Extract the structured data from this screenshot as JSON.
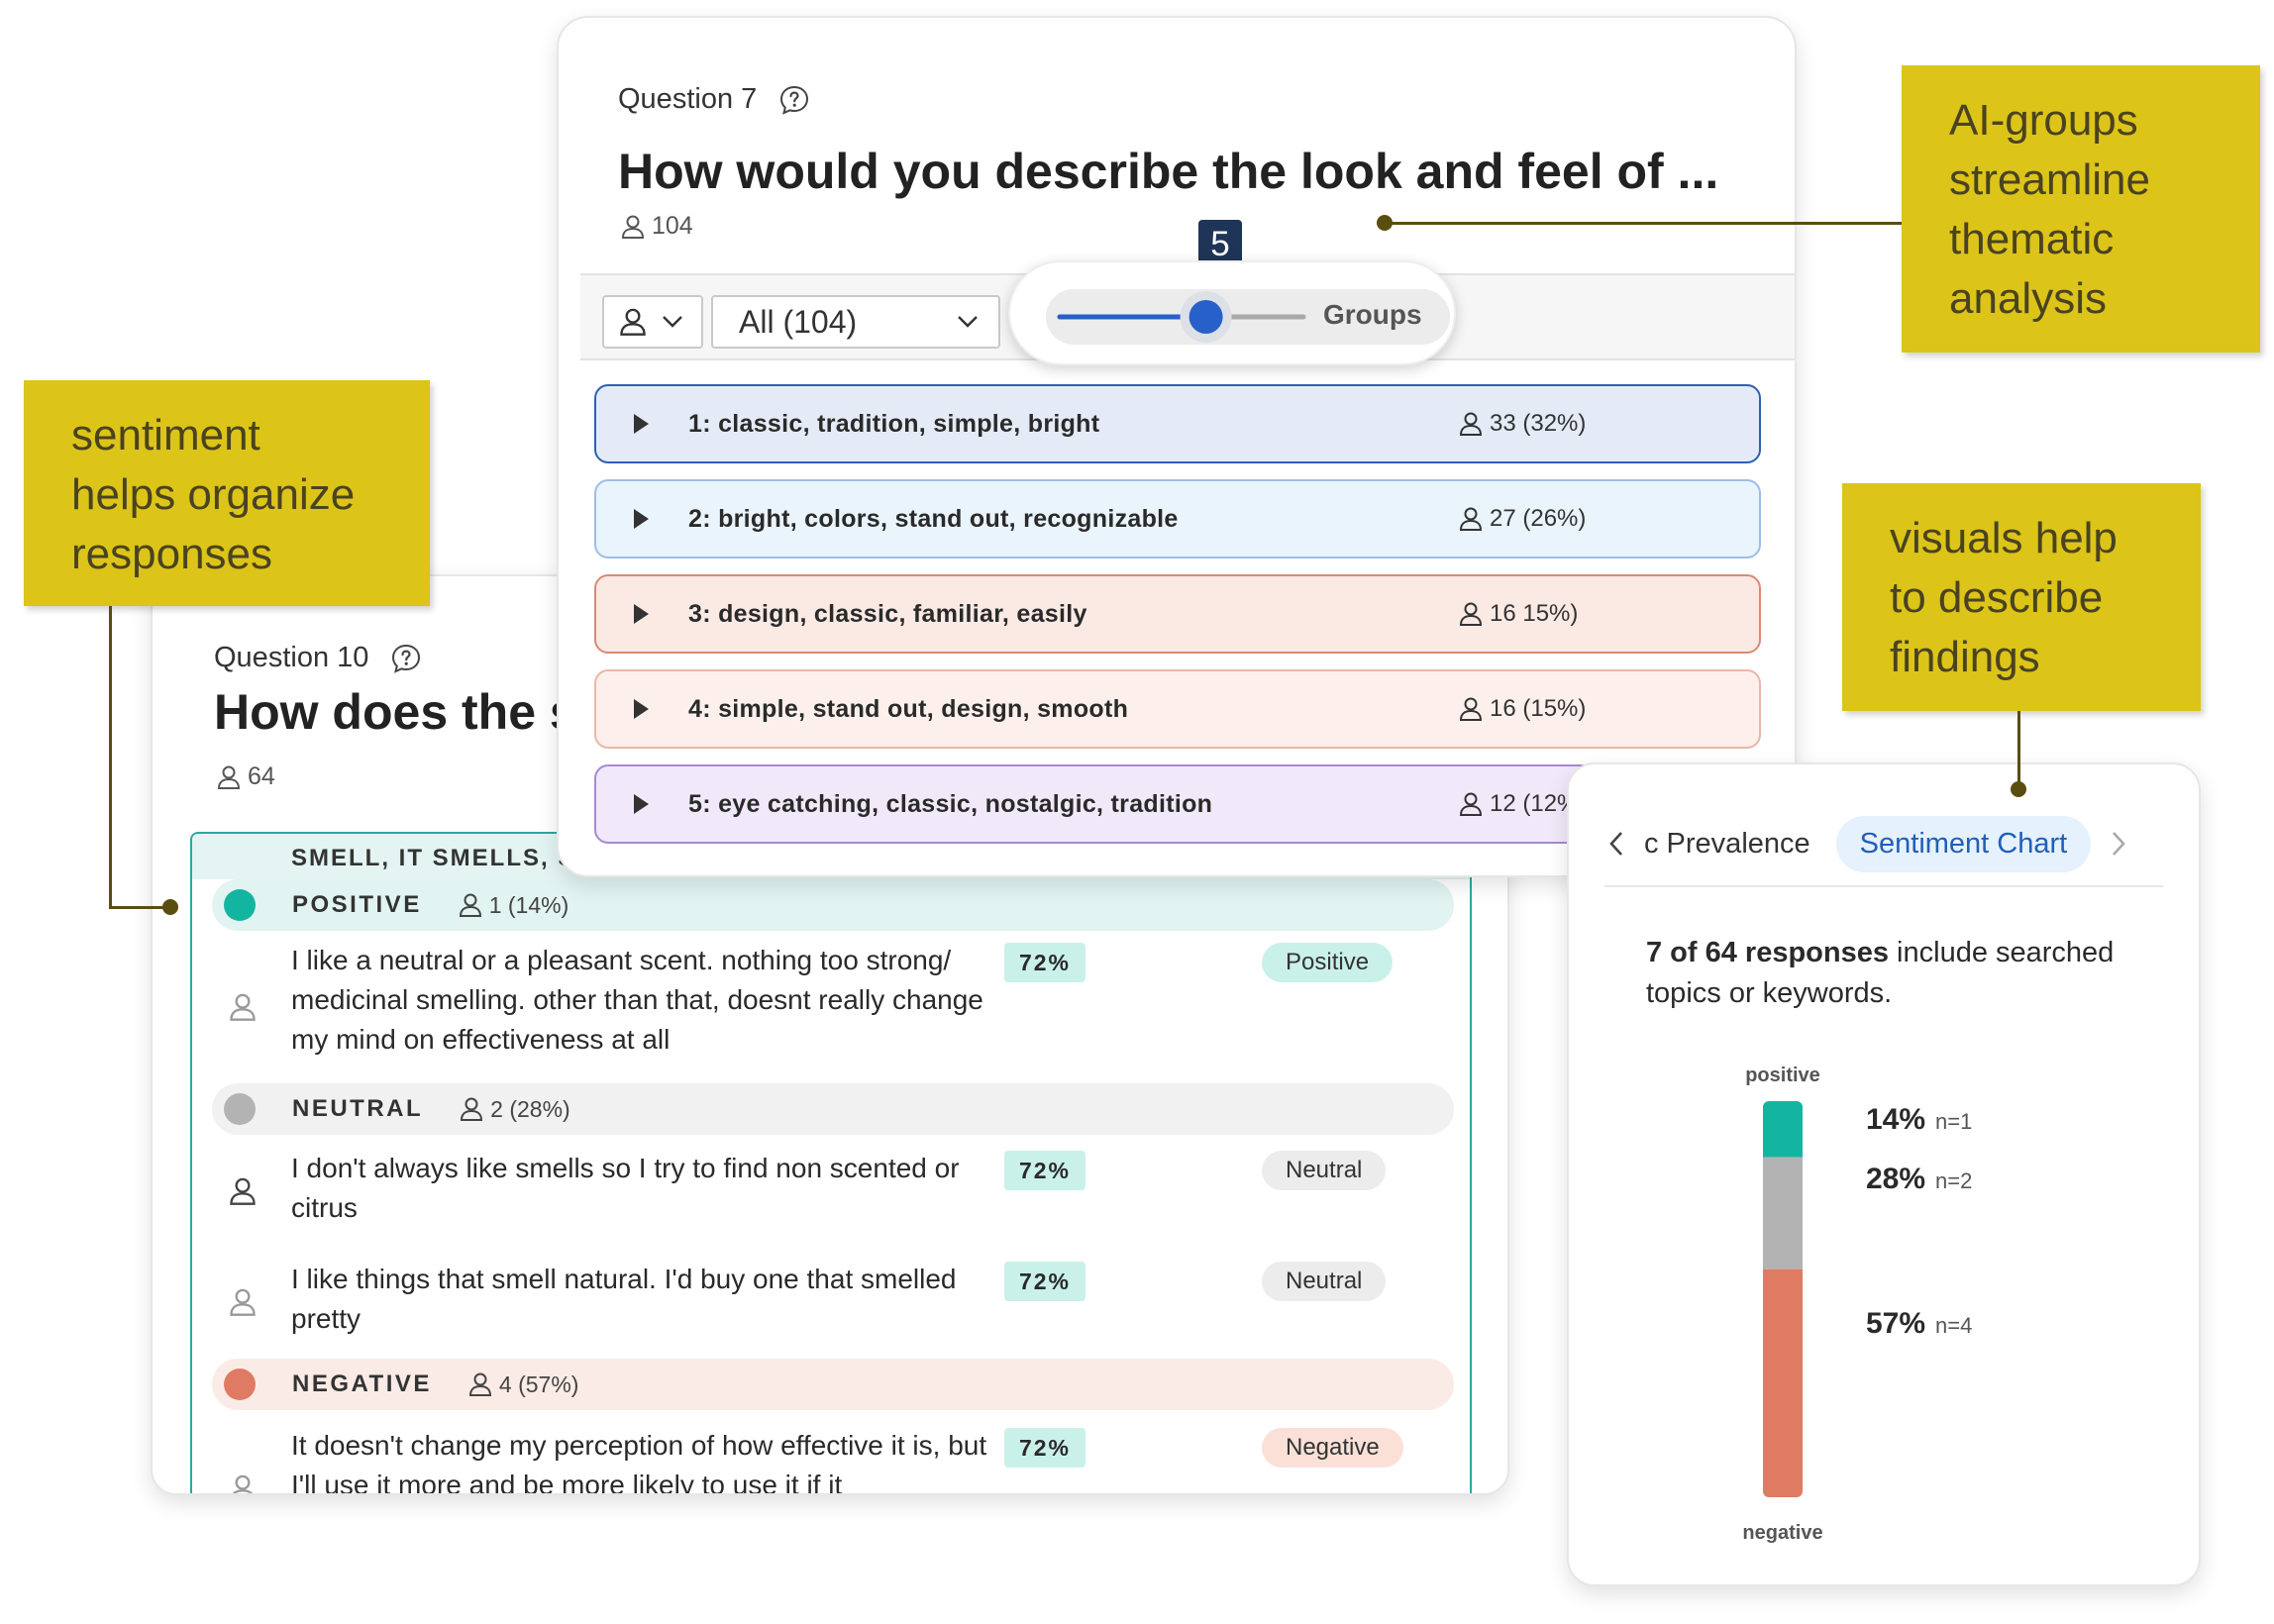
{
  "notes": {
    "ai_groups": [
      "AI-groups",
      "streamline",
      "thematic",
      "analysis"
    ],
    "sentiment": [
      "sentiment",
      "helps organize",
      "responses"
    ],
    "visuals": [
      "visuals help",
      "to describe",
      "findings"
    ]
  },
  "q7": {
    "label": "Question 7",
    "title": "How would you describe the look and feel of ...",
    "respondents": "104",
    "filter_value": "All (104)",
    "slider_value": "5",
    "slider_fraction": 0.6,
    "slider_label": "Groups",
    "groups": [
      {
        "name": "1: classic, tradition, simple, bright",
        "count": "33 (32%)",
        "bg": "#e4ebf7",
        "border": "#2e5fb5"
      },
      {
        "name": "2: bright, colors, stand out, recognizable",
        "count": "27 (26%)",
        "bg": "#eaf4fd",
        "border": "#9fbde6"
      },
      {
        "name": "3: design, classic, familiar, easily",
        "count": "16 15%)",
        "bg": "#fbe9e4",
        "border": "#d88a78"
      },
      {
        "name": "4: simple, stand out, design, smooth",
        "count": "16 (15%)",
        "bg": "#fdf0ec",
        "border": "#ebb6a8"
      },
      {
        "name": "5: eye catching, classic, nostalgic, tradition",
        "count": "12 (12%)",
        "bg": "#f1e9f9",
        "border": "#a988cf"
      }
    ]
  },
  "q10": {
    "label": "Question 10",
    "title": "How does the s",
    "respondents": "64",
    "theme": "SMELL, IT SMELLS, S",
    "groups": {
      "positive": {
        "label": "POSITIVE",
        "count": "1 (14%)",
        "color": "#14b5a0",
        "bg": "#e1f4f1"
      },
      "neutral": {
        "label": "NEUTRAL",
        "count": "2 (28%)",
        "color": "#b3b3b3",
        "bg": "#f1f1f1"
      },
      "negative": {
        "label": "NEGATIVE",
        "count": "4 (57%)",
        "color": "#e07b63",
        "bg": "#fbebe6"
      }
    },
    "responses": [
      {
        "text": "I like a neutral or a pleasant scent. nothing too strong/ medicinal smelling. other than that, doesnt really change my mind on effectiveness at all",
        "pct": "72%",
        "badge": "Positive"
      },
      {
        "text": "I don't always like smells so I try to find non scented or citrus",
        "pct": "72%",
        "badge": "Neutral"
      },
      {
        "text": "I like things that smell natural. I'd buy one that smelled pretty",
        "pct": "72%",
        "badge": "Neutral"
      },
      {
        "text": "It doesn't change my perception of how effective it is, but I'll use it more and be more likely to use it if it",
        "pct": "72%",
        "badge": "Negative"
      }
    ]
  },
  "chart_card": {
    "tab_prev": "c Prevalence",
    "tab_active": "Sentiment Chart",
    "summary_bold": "7 of 64 responses",
    "summary_rest": " include searched topics or keywords.",
    "top_label": "positive",
    "bottom_label": "negative"
  },
  "chart_data": {
    "type": "bar",
    "stacked": true,
    "categories": [
      "positive",
      "neutral",
      "negative"
    ],
    "series": [
      {
        "name": "positive",
        "value": 14,
        "n": "n=1",
        "label": "14%",
        "color": "#14b5a0"
      },
      {
        "name": "neutral",
        "value": 28,
        "n": "n=2",
        "label": "28%",
        "color": "#b3b3b3"
      },
      {
        "name": "negative",
        "value": 57,
        "n": "n=4",
        "label": "57%",
        "color": "#e07b63"
      }
    ]
  }
}
